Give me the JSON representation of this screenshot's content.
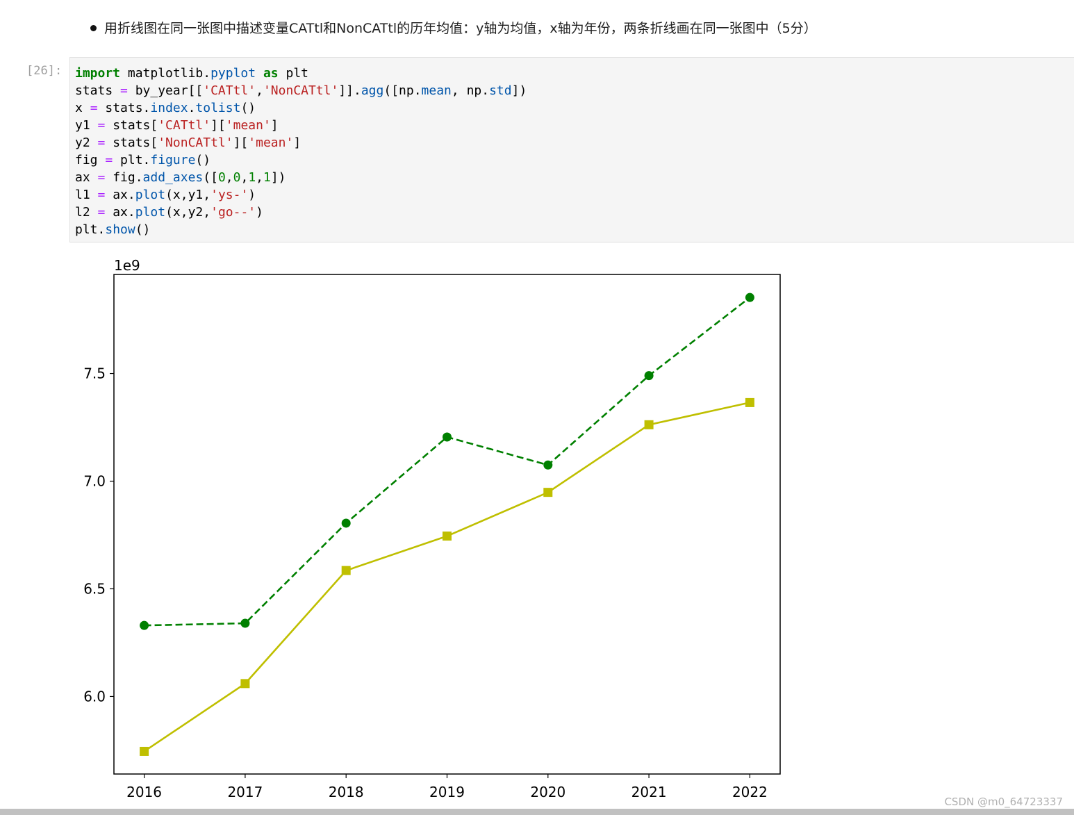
{
  "markdown": {
    "text": "用折线图在同一张图中描述变量CATtl和NonCATtl的历年均值：y轴为均值，x轴为年份，两条折线画在同一张图中（5分）"
  },
  "cell": {
    "prompt": "[26]:"
  },
  "code_lines": [
    [
      {
        "t": "import",
        "c": "kw"
      },
      {
        "t": " matplotlib."
      },
      {
        "t": "pyplot",
        "c": "attr"
      },
      {
        "t": " "
      },
      {
        "t": "as",
        "c": "kw"
      },
      {
        "t": " plt"
      }
    ],
    [
      {
        "t": "stats "
      },
      {
        "t": "=",
        "c": "op"
      },
      {
        "t": " by_year[["
      },
      {
        "t": "'CATtl'",
        "c": "str"
      },
      {
        "t": ","
      },
      {
        "t": "'NonCATtl'",
        "c": "str"
      },
      {
        "t": "]]."
      },
      {
        "t": "agg",
        "c": "attr"
      },
      {
        "t": "([np."
      },
      {
        "t": "mean",
        "c": "attr"
      },
      {
        "t": ", np."
      },
      {
        "t": "std",
        "c": "attr"
      },
      {
        "t": "])"
      }
    ],
    [
      {
        "t": "x "
      },
      {
        "t": "=",
        "c": "op"
      },
      {
        "t": " stats."
      },
      {
        "t": "index",
        "c": "attr"
      },
      {
        "t": "."
      },
      {
        "t": "tolist",
        "c": "attr"
      },
      {
        "t": "()"
      }
    ],
    [
      {
        "t": "y1 "
      },
      {
        "t": "=",
        "c": "op"
      },
      {
        "t": " stats["
      },
      {
        "t": "'CATtl'",
        "c": "str"
      },
      {
        "t": "]["
      },
      {
        "t": "'mean'",
        "c": "str"
      },
      {
        "t": "]"
      }
    ],
    [
      {
        "t": "y2 "
      },
      {
        "t": "=",
        "c": "op"
      },
      {
        "t": " stats["
      },
      {
        "t": "'NonCATtl'",
        "c": "str"
      },
      {
        "t": "]["
      },
      {
        "t": "'mean'",
        "c": "str"
      },
      {
        "t": "]"
      }
    ],
    [
      {
        "t": "fig "
      },
      {
        "t": "=",
        "c": "op"
      },
      {
        "t": " plt."
      },
      {
        "t": "figure",
        "c": "attr"
      },
      {
        "t": "()"
      }
    ],
    [
      {
        "t": "ax "
      },
      {
        "t": "=",
        "c": "op"
      },
      {
        "t": " fig."
      },
      {
        "t": "add_axes",
        "c": "attr"
      },
      {
        "t": "(["
      },
      {
        "t": "0",
        "c": "num"
      },
      {
        "t": ","
      },
      {
        "t": "0",
        "c": "num"
      },
      {
        "t": ","
      },
      {
        "t": "1",
        "c": "num"
      },
      {
        "t": ","
      },
      {
        "t": "1",
        "c": "num"
      },
      {
        "t": "])"
      }
    ],
    [
      {
        "t": "l1 "
      },
      {
        "t": "=",
        "c": "op"
      },
      {
        "t": " ax."
      },
      {
        "t": "plot",
        "c": "attr"
      },
      {
        "t": "(x,y1,"
      },
      {
        "t": "'ys-'",
        "c": "str"
      },
      {
        "t": ")"
      }
    ],
    [
      {
        "t": "l2 "
      },
      {
        "t": "=",
        "c": "op"
      },
      {
        "t": " ax."
      },
      {
        "t": "plot",
        "c": "attr"
      },
      {
        "t": "(x,y2,"
      },
      {
        "t": "'go--'",
        "c": "str"
      },
      {
        "t": ")"
      }
    ],
    [
      {
        "t": "plt."
      },
      {
        "t": "show",
        "c": "attr"
      },
      {
        "t": "()"
      }
    ]
  ],
  "chart_data": {
    "type": "line",
    "x": [
      2016,
      2017,
      2018,
      2019,
      2020,
      2021,
      2022
    ],
    "x_tick_labels": [
      "2016",
      "2017",
      "2018",
      "2019",
      "2020",
      "2021",
      "2022"
    ],
    "y_tick_values": [
      6.0,
      6.5,
      7.0,
      7.5
    ],
    "y_tick_labels": [
      "6.0",
      "6.5",
      "7.0",
      "7.5"
    ],
    "offset_text": "1e9",
    "xlim": [
      2015.7,
      2022.3
    ],
    "ylim": [
      5.64,
      7.96
    ],
    "grid": false,
    "legend": "none",
    "series": [
      {
        "values": [
          5.745,
          6.06,
          6.585,
          6.745,
          6.948,
          7.262,
          7.365
        ],
        "color": "#bfbf00",
        "marker": "square",
        "linestyle": "solid"
      },
      {
        "values": [
          6.33,
          6.34,
          6.805,
          7.205,
          7.075,
          7.49,
          7.853
        ],
        "color": "#008000",
        "marker": "circle",
        "linestyle": "dashed"
      }
    ]
  },
  "watermark": "CSDN @m0_64723337",
  "colors": {
    "series_yellow": "#bfbf00",
    "series_green": "#008000",
    "code_bg": "#f5f5f5"
  }
}
